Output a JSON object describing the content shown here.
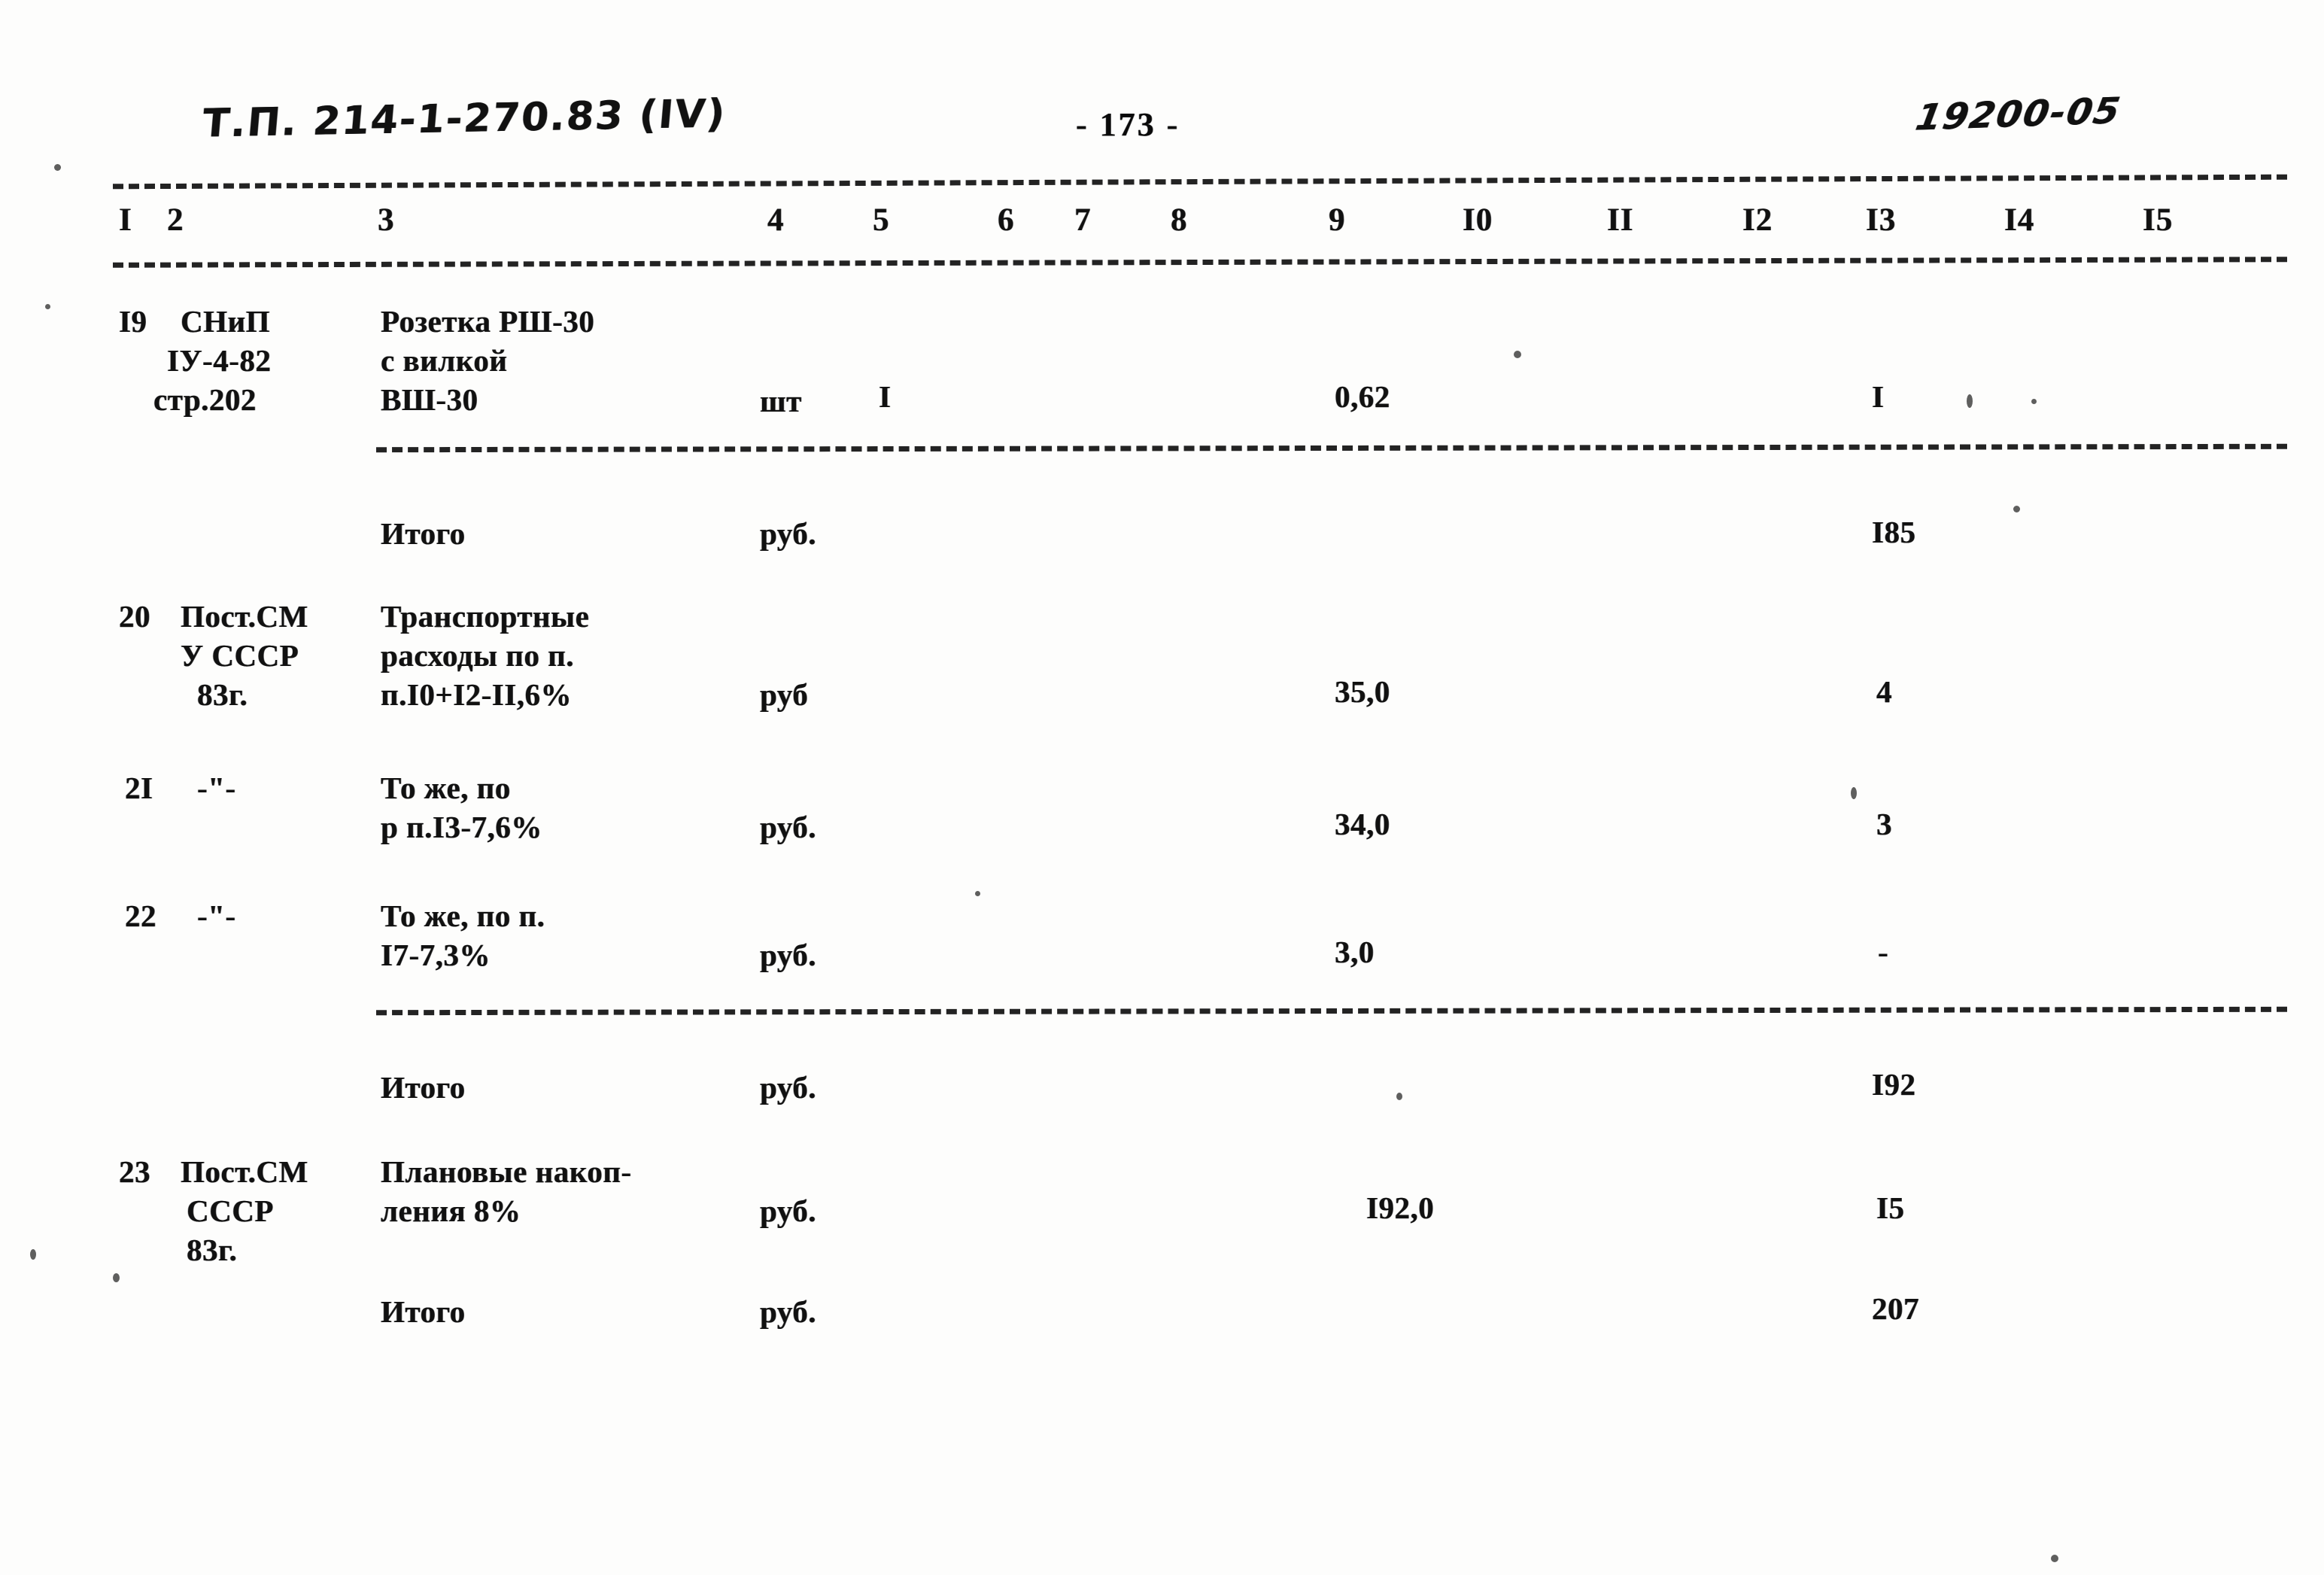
{
  "document": {
    "doc_code": "Т.П. 214-1-270.83 (IV)",
    "page_number": "- 173 -",
    "stamp_code": "19200-05"
  },
  "table": {
    "column_numbers": [
      "I",
      "2",
      "3",
      "4",
      "5",
      "6",
      "7",
      "8",
      "9",
      "I0",
      "II",
      "I2",
      "I3",
      "I4",
      "I5"
    ],
    "rows": [
      {
        "no": "I9",
        "basis": [
          "СНиП",
          "IУ-4-82",
          "стр.202"
        ],
        "description": [
          "Розетка РШ-30",
          "с вилкой",
          "ВШ-30"
        ],
        "unit": "шт",
        "qty": "I",
        "c9": "0,62",
        "c13": "I"
      },
      {
        "no": "",
        "basis": [],
        "description": [
          "Итого"
        ],
        "unit": "руб.",
        "qty": "",
        "c9": "",
        "c13": "I85",
        "kind": "total"
      },
      {
        "no": "20",
        "basis": [
          "Пост.СМ",
          "У СССР",
          "83г."
        ],
        "description": [
          "Транспортные",
          "расходы по п.",
          "п.I0+I2-II,6%"
        ],
        "unit": "руб",
        "qty": "",
        "c9": "35,0",
        "c13": "4"
      },
      {
        "no": "2I",
        "basis": [
          "-\"-"
        ],
        "description": [
          "То же, по",
          "р п.I3-7,6%"
        ],
        "unit": "руб.",
        "qty": "",
        "c9": "34,0",
        "c13": "3"
      },
      {
        "no": "22",
        "basis": [
          "-\"-"
        ],
        "description": [
          "То же, по п.",
          "I7-7,3%"
        ],
        "unit": "руб.",
        "qty": "",
        "c9": "3,0",
        "c13": "-"
      },
      {
        "no": "",
        "basis": [],
        "description": [
          "Итого"
        ],
        "unit": "руб.",
        "qty": "",
        "c9": "",
        "c13": "I92",
        "kind": "total"
      },
      {
        "no": "23",
        "basis": [
          "Пост.СМ",
          "СССР",
          "83г."
        ],
        "description": [
          "Плановые накоп-",
          "ления 8%"
        ],
        "unit": "руб.",
        "qty": "",
        "c9": "I92,0",
        "c13": "I5"
      },
      {
        "no": "",
        "basis": [],
        "description": [
          "Итого"
        ],
        "unit": "руб.",
        "qty": "",
        "c9": "",
        "c13": "207",
        "kind": "total"
      }
    ]
  }
}
